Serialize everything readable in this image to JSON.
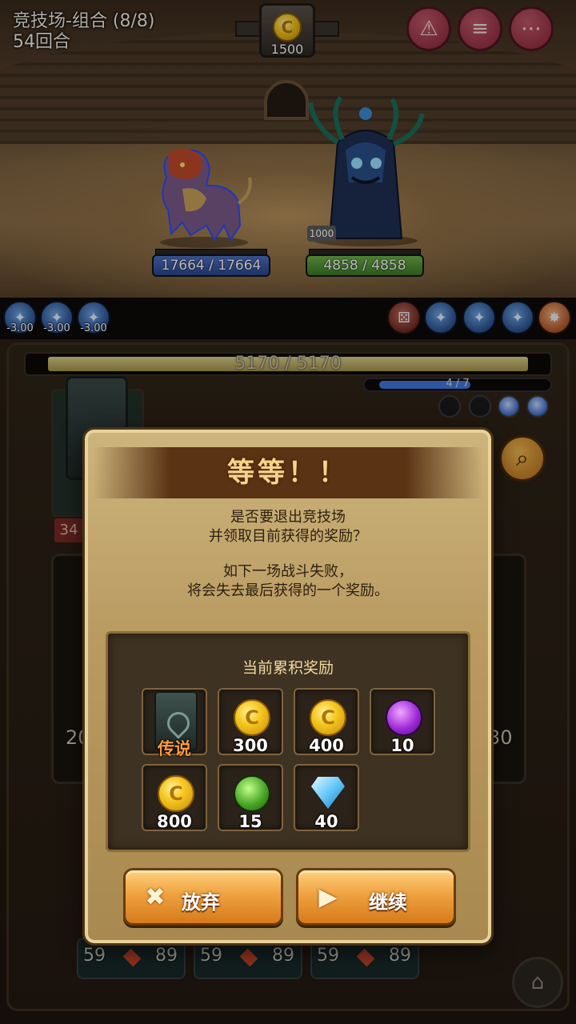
{
  "header": {
    "mode_title": "竞技场-组合 (8/8)",
    "round": "54回合",
    "coin_icon": "C",
    "coins": "1500",
    "buttons": [
      {
        "name": "emblem-icon",
        "glyph": "⚠"
      },
      {
        "name": "scroll-icon",
        "glyph": "≡"
      },
      {
        "name": "more-icon",
        "glyph": "⋯"
      }
    ]
  },
  "battle": {
    "player_hp": "17664 / 17664",
    "enemy_hp": "4858 / 4858",
    "enemy_armor": "1000"
  },
  "buffs": {
    "left": [
      {
        "value": "-3.00"
      },
      {
        "value": "-3.00"
      },
      {
        "value": "-3.00"
      }
    ]
  },
  "board": {
    "player_health": "5170 / 5170",
    "player_health_ratio": 1.0,
    "mana": "4 / 7",
    "mana_ratio": 0.57,
    "left_tag": "34",
    "left_number": "20",
    "right_number": "30",
    "bottom_cards": [
      {
        "left": "59",
        "right": "89"
      },
      {
        "left": "59",
        "right": "89"
      },
      {
        "left": "59",
        "right": "89"
      }
    ]
  },
  "modal": {
    "title": "等等！！",
    "message_line1": "是否要退出竞技场",
    "message_line2": "并领取目前获得的奖励？",
    "warning_line1": "如下一场战斗失败，",
    "warning_line2": "将会失去最后获得的一个奖励。",
    "rewards_title": "当前累积奖励",
    "rewards": [
      {
        "type": "card",
        "label": "传说"
      },
      {
        "type": "coin",
        "label": "300"
      },
      {
        "type": "coin",
        "label": "400"
      },
      {
        "type": "purple-orb",
        "label": "10"
      },
      {
        "type": "coin",
        "label": "800"
      },
      {
        "type": "green-orb",
        "label": "15"
      },
      {
        "type": "diamond",
        "label": "40"
      }
    ],
    "give_up_label": "放弃",
    "continue_label": "继续"
  }
}
